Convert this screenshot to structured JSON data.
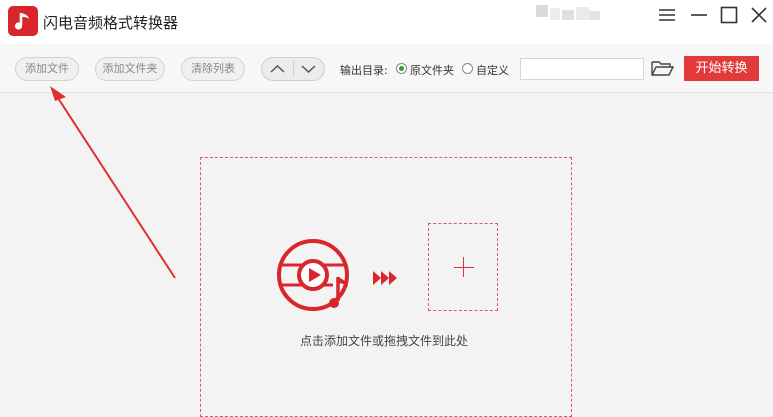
{
  "app": {
    "title": "闪电音频格式转换器"
  },
  "toolbar": {
    "add_file": "添加文件",
    "add_folder": "添加文件夹",
    "clear_list": "清除列表",
    "move_up_icon": "chevron-up-icon",
    "move_down_icon": "chevron-down-icon",
    "output_label": "输出目录:",
    "output_options": [
      {
        "label": "原文件夹",
        "selected": true
      },
      {
        "label": "自定义",
        "selected": false
      }
    ],
    "path_value": "",
    "start_button": "开始转换"
  },
  "main": {
    "hint": "点击添加文件或拖拽文件到此处"
  },
  "colors": {
    "accent": "#e23a3a",
    "radio_selected": "#2aa12a"
  }
}
